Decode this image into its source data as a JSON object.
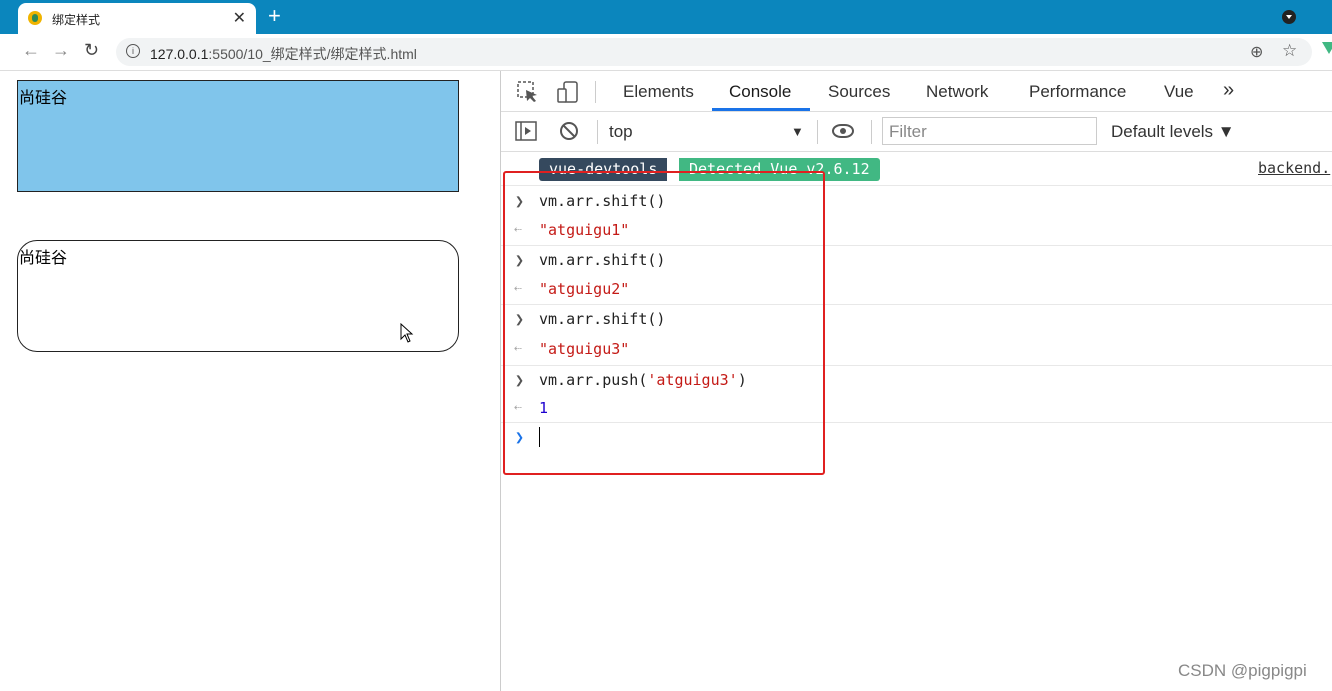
{
  "browser": {
    "tab_title": "绑定样式",
    "tab_close": "✕",
    "new_tab": "+",
    "url_host": "127.0.0.1",
    "url_path": ":5500/10_绑定样式/绑定样式.html"
  },
  "page": {
    "box1_text": "尚硅谷",
    "box1_color": "#80c5eb",
    "box2_text": "尚硅谷"
  },
  "devtools": {
    "tabs": [
      "Elements",
      "Console",
      "Sources",
      "Network",
      "Performance",
      "Vue"
    ],
    "active_tab": "Console",
    "more": "»",
    "context": "top",
    "filter_placeholder": "Filter",
    "levels": "Default levels ▼",
    "vue_badge_1": "vue-devtools",
    "vue_badge_2": "Detected Vue v2.6.12",
    "backend_link": "backend.",
    "console": [
      {
        "type": "input",
        "text": "vm.arr.shift()"
      },
      {
        "type": "output",
        "text": "\"atguigu1\""
      },
      {
        "type": "input",
        "text": "vm.arr.shift()"
      },
      {
        "type": "output",
        "text": "\"atguigu2\""
      },
      {
        "type": "input",
        "text": "vm.arr.shift()"
      },
      {
        "type": "output",
        "text": "\"atguigu3\""
      },
      {
        "type": "input",
        "text_prefix": "vm.arr.push(",
        "text_arg": "'atguigu3'",
        "text_suffix": ")"
      },
      {
        "type": "output-number",
        "text": "1"
      }
    ],
    "accent": "#1a73e8",
    "highlight_color": "#e02020"
  },
  "watermark": "CSDN @pigpigpi"
}
